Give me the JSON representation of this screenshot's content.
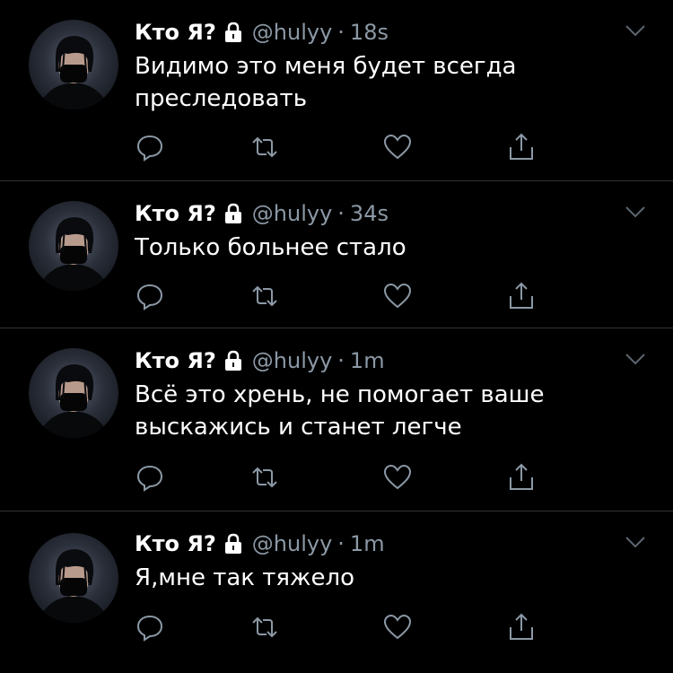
{
  "tweets": [
    {
      "name": "Кто Я?",
      "handle": "@hulyy",
      "separator": "·",
      "time": "18s",
      "text": "Видимо это меня будет всегда\nпреследовать"
    },
    {
      "name": "Кто Я?",
      "handle": "@hulyy",
      "separator": "·",
      "time": "34s",
      "text": "Только больнее стало"
    },
    {
      "name": "Кто Я?",
      "handle": "@hulyy",
      "separator": "·",
      "time": "1m",
      "text": "Всё это хрень, не помогает ваше\nвыскажись и станет легче"
    },
    {
      "name": "Кто Я?",
      "handle": "@hulyy",
      "separator": "·",
      "time": "1m",
      "text": "Я,мне так тяжело"
    }
  ],
  "icons": {
    "lock": "lock-icon",
    "caret": "chevron-down-icon",
    "reply": "reply-icon",
    "retweet": "retweet-icon",
    "like": "heart-icon",
    "share": "share-icon"
  },
  "colors": {
    "background": "#000000",
    "text": "#ffffff",
    "secondary": "#8b98a5",
    "divider": "#2f3336"
  }
}
